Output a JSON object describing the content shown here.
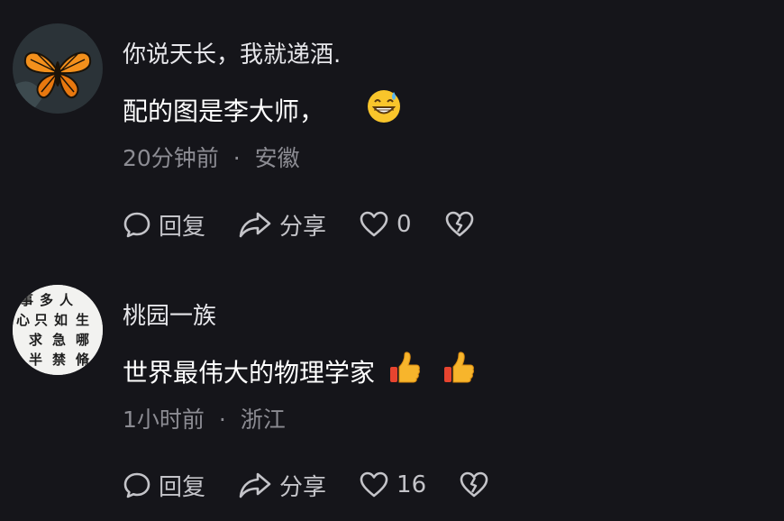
{
  "comments": [
    {
      "username": "你说天长，我就递酒.",
      "text": "配的图是李大师，",
      "emojis": [
        "grinning-sweat-emoji"
      ],
      "time": "20分钟前",
      "separator": "·",
      "location": "安徽",
      "reply_label": "回复",
      "share_label": "分享",
      "like_count": "0",
      "avatar": "butterfly-avatar"
    },
    {
      "username": "桃园一族",
      "text": "世界最伟大的物理学家",
      "emojis": [
        "thumbs-up-emoji",
        "thumbs-up-emoji"
      ],
      "time": "1小时前",
      "separator": "·",
      "location": "浙江",
      "reply_label": "回复",
      "share_label": "分享",
      "like_count": "16",
      "avatar": "calligraphy-avatar",
      "avatar_text": "事多人心只如生求急哪半禁脩"
    }
  ],
  "colors": {
    "background": "#15151a",
    "text": "#ffffff",
    "meta": "#8c8c93",
    "icon": "#c4c4c9"
  }
}
